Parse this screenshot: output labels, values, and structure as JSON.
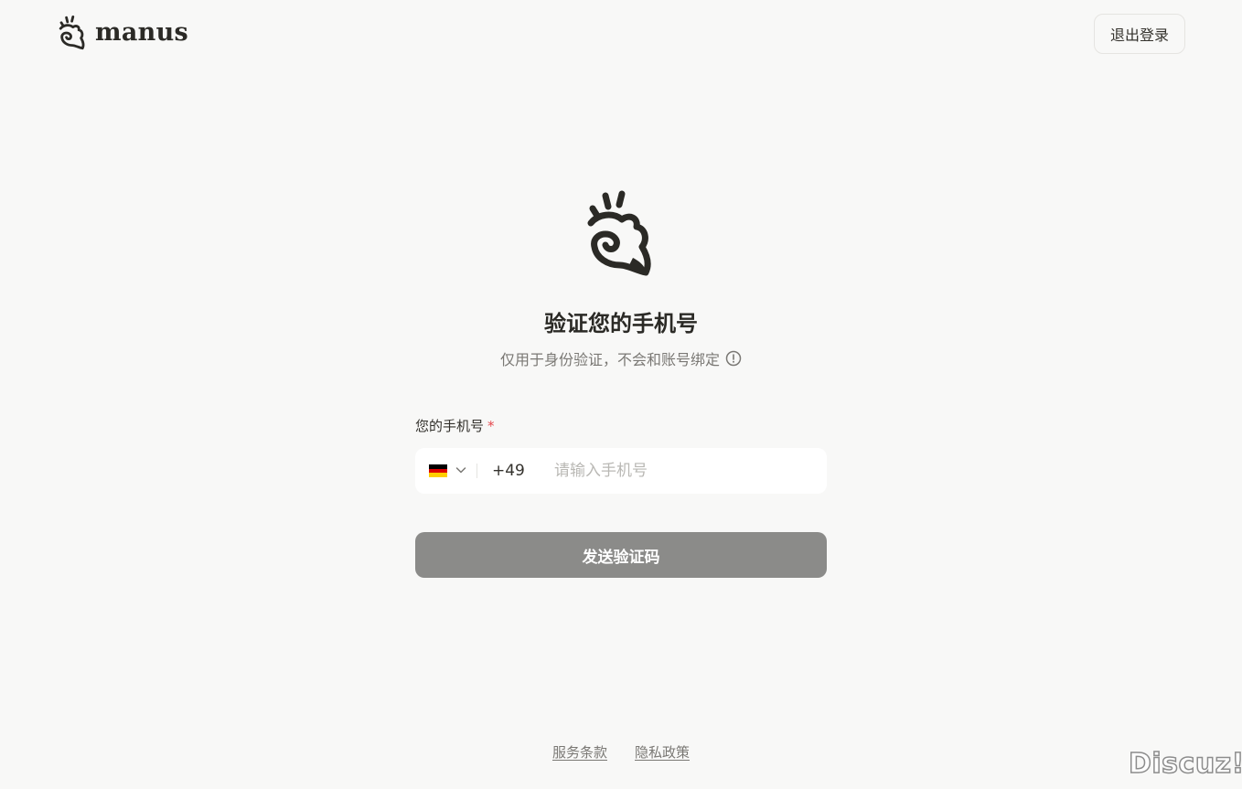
{
  "header": {
    "brand_name": "manus",
    "logout_label": "退出登录"
  },
  "main": {
    "title": "验证您的手机号",
    "subtitle": "仅用于身份验证，不会和账号绑定",
    "phone_label": "您的手机号",
    "required_mark": "*",
    "country_code": "+49",
    "phone_placeholder": "请输入手机号",
    "phone_value": "",
    "send_button_label": "发送验证码"
  },
  "footer": {
    "terms_label": "服务条款",
    "privacy_label": "隐私政策"
  },
  "watermark": "Discuz!",
  "icons": {
    "brand_logo": "manus-hand-logo-icon",
    "info": "info-circle-icon",
    "flag": "germany-flag-icon",
    "chevron": "chevron-down-icon"
  },
  "colors": {
    "background": "#f8f8f7",
    "button_disabled": "#8b8b89",
    "required": "#e5484d",
    "flag_black": "#000000",
    "flag_red": "#dd0000",
    "flag_gold": "#ffce00"
  }
}
